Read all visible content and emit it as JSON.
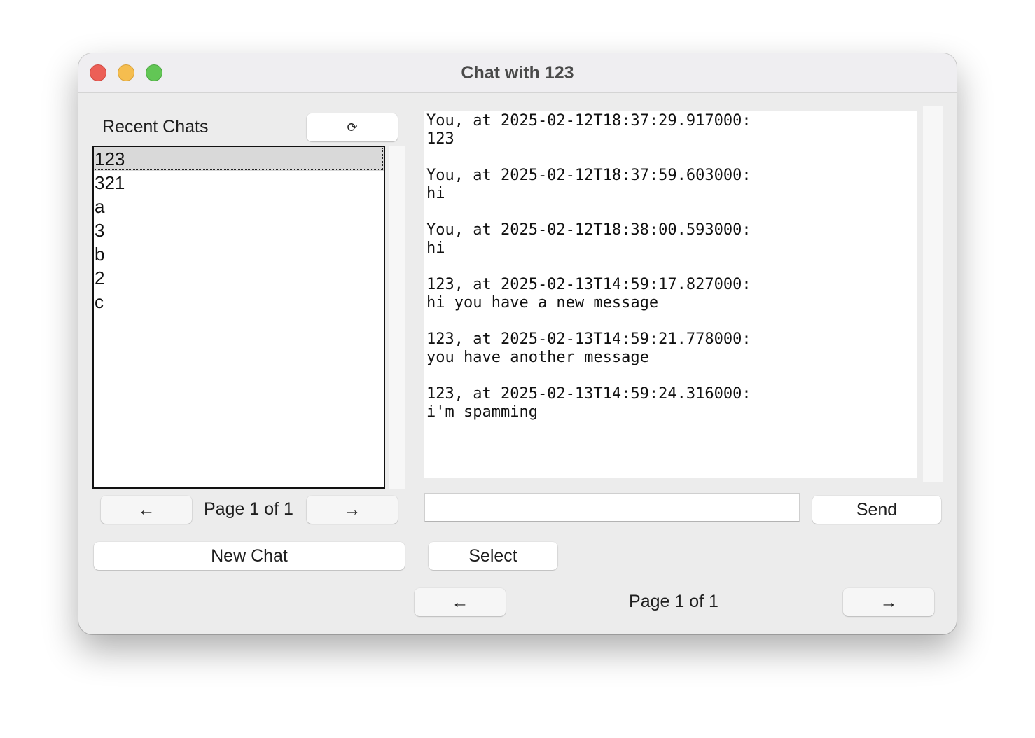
{
  "window": {
    "title": "Chat with 123"
  },
  "sidebar": {
    "heading": "Recent Chats",
    "refresh_icon": "⟳",
    "chats": [
      "123",
      "321",
      "a",
      "3",
      "b",
      "2",
      "c"
    ],
    "selected_index": 0,
    "prev_icon": "←",
    "next_icon": "→",
    "page_label": "Page 1 of 1",
    "new_chat_label": "New Chat"
  },
  "chat": {
    "messages": [
      {
        "header": "You, at 2025-02-12T18:37:29.917000:",
        "text": "123"
      },
      {
        "header": "You, at 2025-02-12T18:37:59.603000:",
        "text": "hi"
      },
      {
        "header": "You, at 2025-02-12T18:38:00.593000:",
        "text": "hi"
      },
      {
        "header": "123, at 2025-02-13T14:59:17.827000:",
        "text": "hi you have a new message"
      },
      {
        "header": "123, at 2025-02-13T14:59:21.778000:",
        "text": "you have another message"
      },
      {
        "header": "123, at 2025-02-13T14:59:24.316000:",
        "text": "i'm spamming"
      }
    ],
    "input_value": "",
    "send_label": "Send",
    "select_label": "Select",
    "prev_icon": "←",
    "next_icon": "→",
    "page_label": "Page 1 of 1"
  }
}
